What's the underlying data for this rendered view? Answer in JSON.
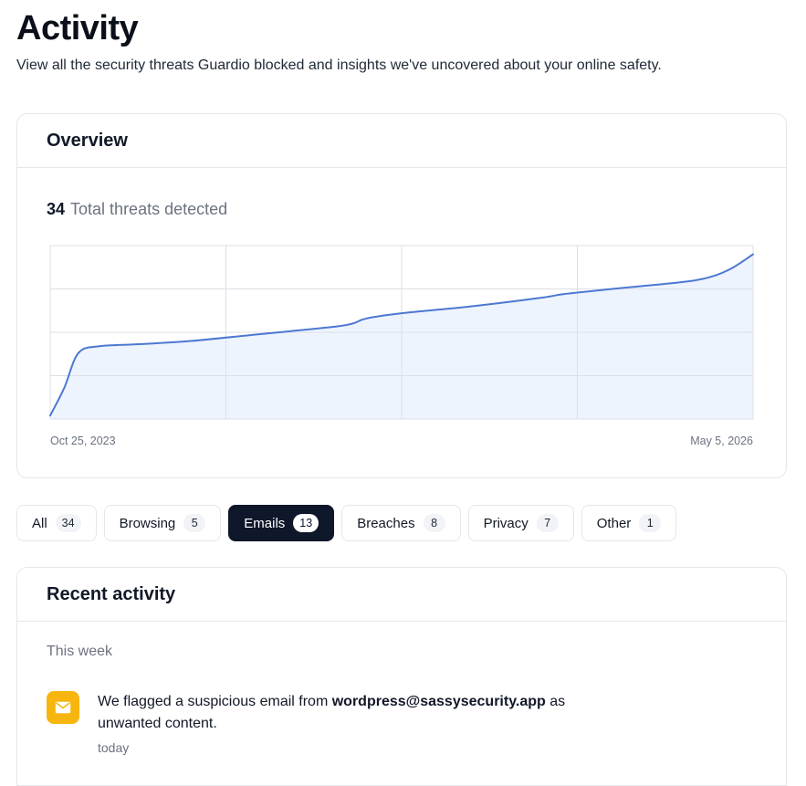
{
  "header": {
    "title": "Activity",
    "subtitle": "View all the security threats Guardio blocked and insights we've uncovered about your online safety."
  },
  "overview": {
    "title": "Overview",
    "total_count": "34",
    "total_label": "Total threats detected",
    "start_date": "Oct 25, 2023",
    "end_date": "May 5, 2026"
  },
  "chart_data": {
    "type": "area",
    "x": [
      0,
      0.02,
      0.04,
      0.07,
      0.12,
      0.2,
      0.3,
      0.4,
      0.43,
      0.45,
      0.5,
      0.6,
      0.7,
      0.73,
      0.8,
      0.9,
      0.94,
      0.97,
      1.0
    ],
    "values": [
      2,
      18,
      38,
      42,
      43,
      45,
      49,
      53,
      55,
      58,
      61,
      65,
      70,
      72,
      75,
      79,
      82,
      87,
      95
    ],
    "ylim": [
      0,
      100
    ],
    "grid": true,
    "colors": {
      "line": "#4d78d2",
      "fill": "#eef4fd",
      "grid": "#dcdfe6"
    }
  },
  "tabs": [
    {
      "label": "All",
      "count": "34",
      "active": false
    },
    {
      "label": "Browsing",
      "count": "5",
      "active": false
    },
    {
      "label": "Emails",
      "count": "13",
      "active": true
    },
    {
      "label": "Breaches",
      "count": "8",
      "active": false
    },
    {
      "label": "Privacy",
      "count": "7",
      "active": false
    },
    {
      "label": "Other",
      "count": "1",
      "active": false
    }
  ],
  "recent": {
    "title": "Recent activity",
    "section_label": "This week",
    "items": [
      {
        "icon": "mail-icon",
        "text_before": "We flagged a suspicious email from ",
        "sender": "wordpress@sassysecurity.app",
        "text_after": " as unwanted content.",
        "time": "today"
      }
    ]
  },
  "colors": {
    "accent_dark": "#0f172a",
    "mail_badge": "#f7b60f",
    "muted_text": "#6b7280"
  }
}
